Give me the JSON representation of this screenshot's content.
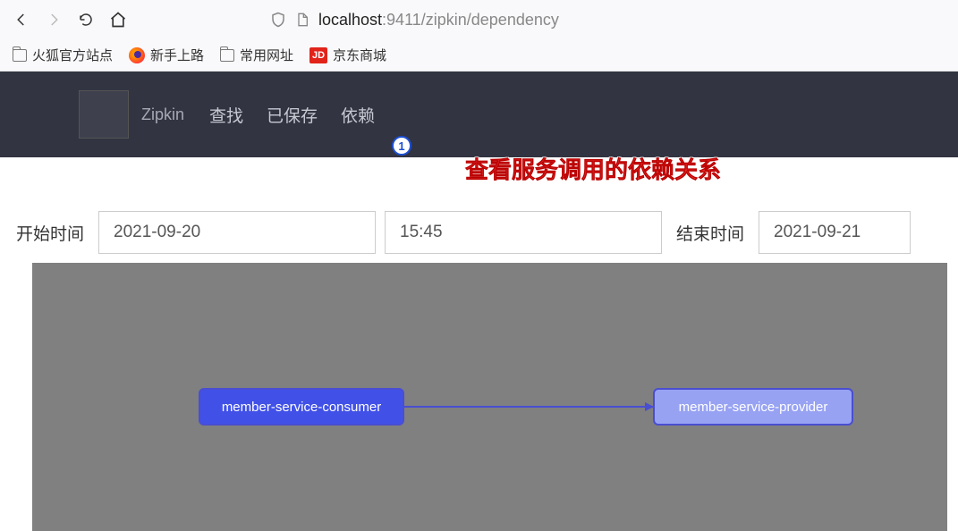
{
  "browser": {
    "url_host": "localhost",
    "url_port_path": ":9411/zipkin/dependency"
  },
  "bookmarks": {
    "ff_official": "火狐官方站点",
    "getting_started": "新手上路",
    "common_sites": "常用网址",
    "jd_label": "JD",
    "jd_text": "京东商城"
  },
  "header": {
    "brand": "Zipkin",
    "nav_search": "查找",
    "nav_saved": "已保存",
    "nav_dependency": "依赖",
    "step_number": "1"
  },
  "annotation": {
    "text": "查看服务调用的依赖关系"
  },
  "filters": {
    "start_label": "开始时间",
    "start_date": "2021-09-20",
    "start_time": "15:45",
    "end_label": "结束时间",
    "end_date": "2021-09-21"
  },
  "graph": {
    "consumer_label": "member-service-consumer",
    "provider_label": "member-service-provider"
  }
}
